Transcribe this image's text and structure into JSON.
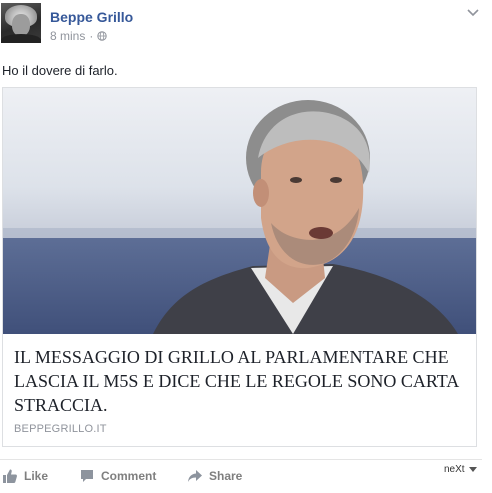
{
  "post": {
    "author": "Beppe Grillo",
    "time": "8 mins",
    "separator": "·",
    "text": "Ho il dovere di farlo."
  },
  "link_card": {
    "title": "IL MESSAGGIO DI GRILLO AL PARLAMENTARE CHE LASCIA IL M5S E DICE CHE LE REGOLE SONO CARTA STRACCIA.",
    "domain": "BEPPEGRILLO.IT"
  },
  "actions": {
    "like": "Like",
    "comment": "Comment",
    "share": "Share"
  },
  "next_widget": {
    "label": "neXt"
  },
  "icons": {
    "privacy": "globe-icon",
    "menu": "chevron-down-icon",
    "like": "thumbs-up-icon",
    "comment": "comment-icon",
    "share": "share-arrow-icon",
    "next": "dropdown-triangle-icon"
  },
  "colors": {
    "author_link": "#365899",
    "meta_text": "#90949c",
    "action_text": "#7f7f7f",
    "card_border": "#dddfe2"
  }
}
